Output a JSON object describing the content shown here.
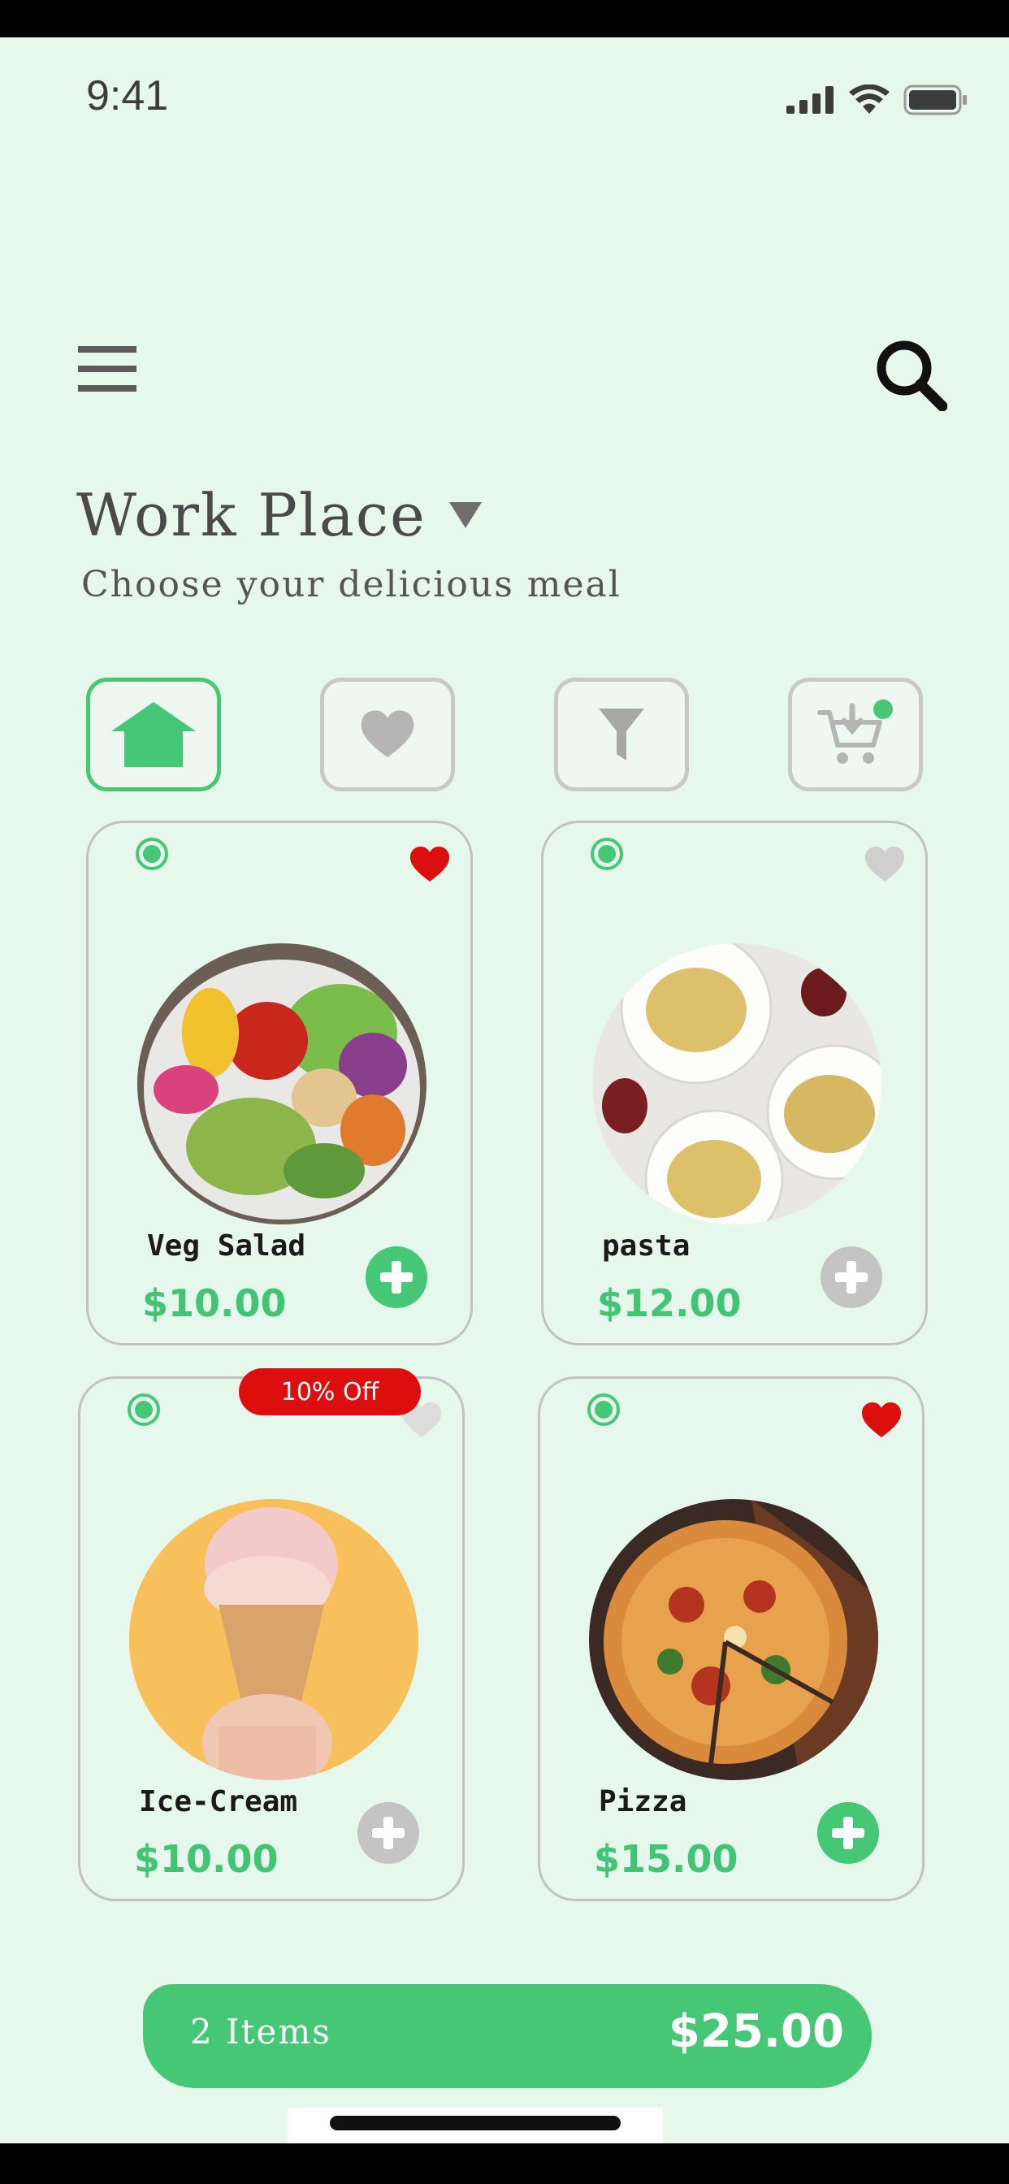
{
  "status": {
    "time": "9:41"
  },
  "header": {
    "title": "Work Place",
    "subtitle": "Choose your delicious meal"
  },
  "tabs": [
    {
      "name": "home",
      "active": true
    },
    {
      "name": "favorites",
      "active": false
    },
    {
      "name": "filter",
      "active": false
    },
    {
      "name": "cart",
      "active": false,
      "notification": true
    }
  ],
  "items": [
    {
      "name": "Veg Salad",
      "price": "$10.00",
      "favorite": true,
      "add_active": true
    },
    {
      "name": "pasta",
      "price": "$12.00",
      "favorite": false,
      "add_active": false
    },
    {
      "name": "Ice-Cream",
      "price": "$10.00",
      "favorite": false,
      "add_active": false,
      "badge": "10% Off"
    },
    {
      "name": "Pizza",
      "price": "$15.00",
      "favorite": true,
      "add_active": true
    }
  ],
  "cart": {
    "items": "2 Items",
    "total": "$25.00"
  },
  "colors": {
    "accent": "#45c776",
    "background": "#e6f7ec",
    "heart_active": "#dd0e0e",
    "inactive": "#c4c4c4"
  }
}
